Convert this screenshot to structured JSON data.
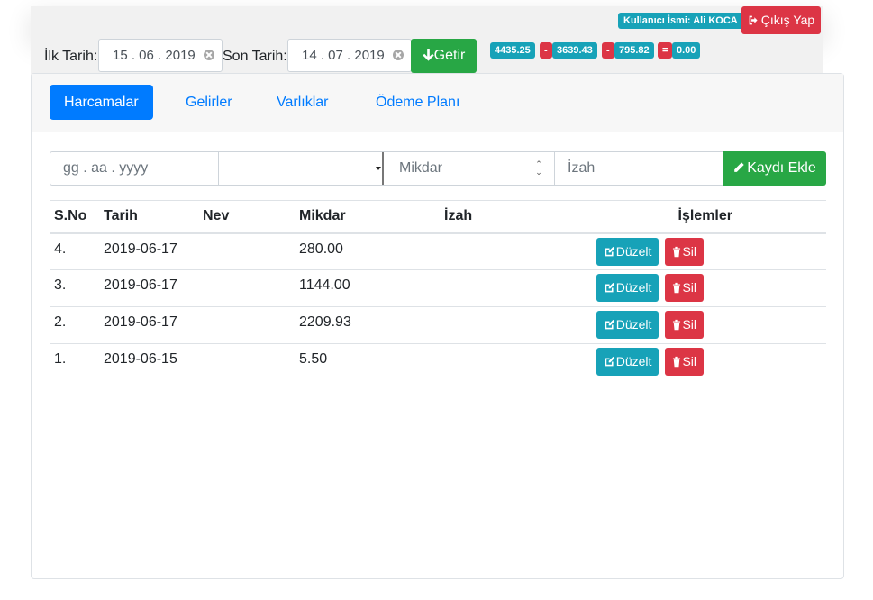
{
  "header": {
    "user_label": "Kullanıcı İsmi: Ali KOCA",
    "logout_label": "Çıkış Yap"
  },
  "filters": {
    "start_label": "İlk Tarih:",
    "start_value": "15 . 06 . 2019",
    "end_label": "Son Tarih:",
    "end_value": "14 . 07 . 2019",
    "fetch_label": "Getir"
  },
  "summary": {
    "income": "4435.25",
    "minus1": "-",
    "expense": "3639.43",
    "minus2": "-",
    "assets": "795.82",
    "equals": "=",
    "balance": "0.00"
  },
  "tabs": [
    {
      "label": "Harcamalar",
      "active": true
    },
    {
      "label": "Gelirler",
      "active": false
    },
    {
      "label": "Varlıklar",
      "active": false
    },
    {
      "label": "Ödeme Planı",
      "active": false
    }
  ],
  "form": {
    "date_placeholder": "gg . aa . yyyy",
    "type_value": "",
    "amount_placeholder": "Mikdar",
    "note_placeholder": "İzah",
    "add_label": "Kaydı Ekle"
  },
  "table": {
    "headers": [
      "S.No",
      "Tarih",
      "Nev",
      "Mikdar",
      "İzah",
      "İşlemler"
    ],
    "edit_label": "Düzelt",
    "delete_label": "Sil",
    "rows": [
      {
        "no": "4.",
        "date": "2019-06-17",
        "type": "",
        "amount": "280.00",
        "note": ""
      },
      {
        "no": "3.",
        "date": "2019-06-17",
        "type": "",
        "amount": "1144.00",
        "note": ""
      },
      {
        "no": "2.",
        "date": "2019-06-17",
        "type": "",
        "amount": "2209.93",
        "note": ""
      },
      {
        "no": "1.",
        "date": "2019-06-15",
        "type": "",
        "amount": "5.50",
        "note": ""
      }
    ]
  },
  "colors": {
    "primary": "#007bff",
    "success": "#28a745",
    "danger": "#dc3545",
    "info": "#17a2b8"
  }
}
